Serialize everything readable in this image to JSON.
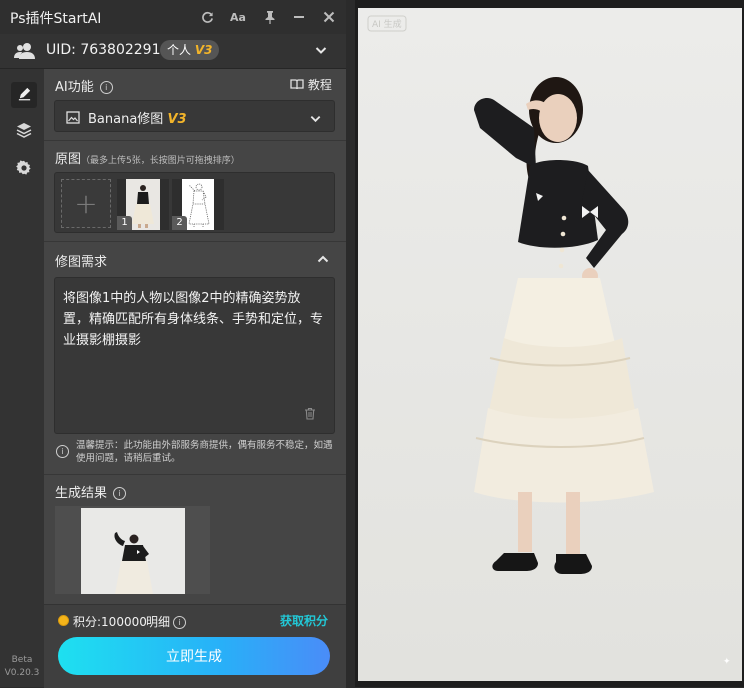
{
  "app": {
    "title": "Ps插件StartAI"
  },
  "user": {
    "uid_label": "UID: 763802291",
    "plan": "个人",
    "plan_version": "V3"
  },
  "ai_section": {
    "label": "AI功能",
    "tutorial": "教程",
    "model_name": "Banana修图",
    "model_version": "V3"
  },
  "source_images": {
    "label": "原图",
    "hint": "（最多上传5张，长按图片可拖拽排序）",
    "items": [
      {
        "index": "1"
      },
      {
        "index": "2"
      }
    ]
  },
  "requirements": {
    "label": "修图需求",
    "prompt": "将图像1中的人物以图像2中的精确姿势放置，精确匹配所有身体线条、手势和定位，专业摄影棚摄影"
  },
  "notice": "温馨提示：此功能由外部服务商提供，偶有服务不稳定，如遇使用问题，请稍后重试。",
  "result": {
    "label": "生成结果"
  },
  "footer": {
    "points": "积分:100000",
    "detail": "明细",
    "get_points": "获取积分",
    "generate": "立即生成"
  },
  "version": {
    "tag": "Beta",
    "number": "V0.20.3"
  },
  "canvas_watermark": "AI 生成",
  "colors": {
    "accent": "#22c8d6",
    "badge_gold": "#f2b42a",
    "panel_bg": "#3c3c3c"
  }
}
